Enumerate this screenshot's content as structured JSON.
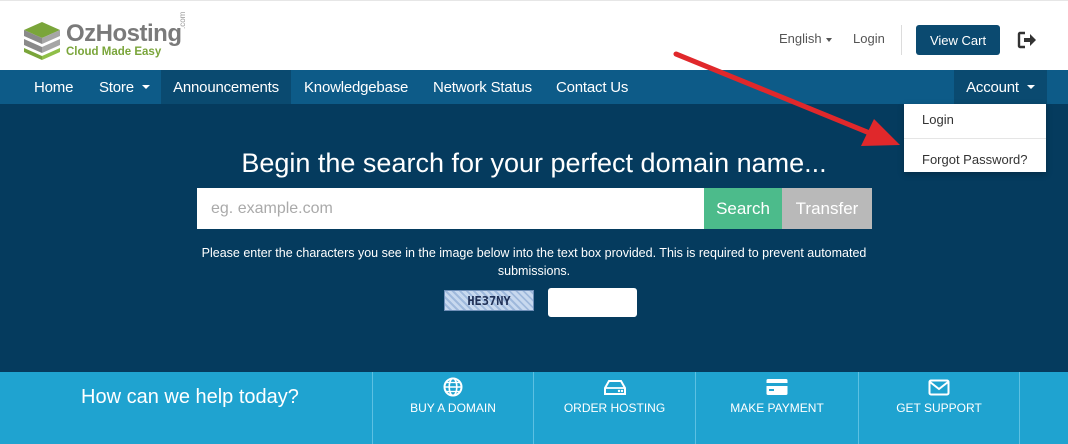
{
  "header": {
    "logo_name": "OzHosting",
    "logo_tagline": "Cloud Made Easy",
    "logo_com": ".com",
    "language_label": "English",
    "login_label": "Login",
    "view_cart_label": "View Cart",
    "logout_icon": "logout-icon"
  },
  "navbar": {
    "items": [
      {
        "label": "Home"
      },
      {
        "label": "Store"
      },
      {
        "label": "Announcements"
      },
      {
        "label": "Knowledgebase"
      },
      {
        "label": "Network Status"
      },
      {
        "label": "Contact Us"
      }
    ],
    "account_label": "Account",
    "active_item": "Announcements"
  },
  "account_dropdown": {
    "items": [
      {
        "label": "Login"
      },
      {
        "label": "Forgot Password?"
      }
    ]
  },
  "hero": {
    "title": "Begin the search for your perfect domain name...",
    "search_placeholder": "eg. example.com",
    "search_button": "Search",
    "transfer_button": "Transfer",
    "captcha_instructions": "Please enter the characters you see in the image below into the text box provided. This is required to prevent automated submissions.",
    "captcha_code": "HE37NY"
  },
  "helpbar": {
    "title": "How can we help today?",
    "items": [
      {
        "label": "BUY A DOMAIN",
        "icon": "globe-icon"
      },
      {
        "label": "ORDER HOSTING",
        "icon": "server-icon"
      },
      {
        "label": "MAKE PAYMENT",
        "icon": "credit-card-icon"
      },
      {
        "label": "GET SUPPORT",
        "icon": "envelope-icon"
      }
    ]
  },
  "colors": {
    "nav_bg": "#0d5b88",
    "hero_bg": "#053b5e",
    "search_button": "#4cbb8b",
    "transfer_button": "#b9b9b9",
    "helpbar_bg": "#1fa3d0",
    "view_cart_bg": "#0b4a70",
    "annotation_arrow": "#e0282b"
  }
}
